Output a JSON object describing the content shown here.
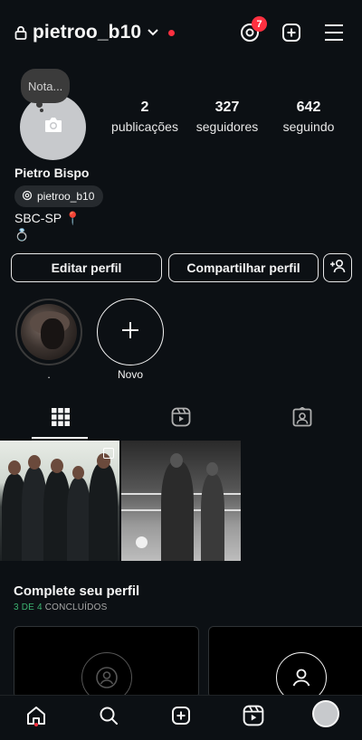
{
  "header": {
    "username": "pietroo_b10",
    "threads_badge": "7",
    "icons": [
      "lock-icon",
      "chevron-down-icon",
      "threads-icon",
      "create-icon",
      "menu-icon"
    ],
    "live_dot_color": "#ff3040"
  },
  "note": {
    "label": "Nota..."
  },
  "stats": [
    {
      "value": "2",
      "label": "publicações"
    },
    {
      "value": "327",
      "label": "seguidores"
    },
    {
      "value": "642",
      "label": "seguindo"
    }
  ],
  "profile": {
    "full_name": "Pietro Bispo",
    "threads_handle": "pietroo_b10",
    "bio_location": "SBC-SP 📍",
    "bio_emoji": "💍"
  },
  "actions": {
    "edit_label": "Editar perfil",
    "share_label": "Compartilhar perfil"
  },
  "highlights": [
    {
      "label": "."
    },
    {
      "label": "Novo"
    }
  ],
  "tabs": [
    "grid-icon",
    "reels-icon",
    "tagged-icon"
  ],
  "complete_profile": {
    "title": "Complete seu perfil",
    "progress": "3 DE 4",
    "progress_suffix": " CONCLUÍDOS",
    "completed": 3,
    "total": 4
  },
  "bottom_nav": [
    "home-icon",
    "search-icon",
    "create-icon",
    "reels-icon",
    "profile-avatar"
  ],
  "colors": {
    "background": "#0c1014",
    "accent_red": "#ff3040",
    "accent_green": "#3cb371"
  }
}
